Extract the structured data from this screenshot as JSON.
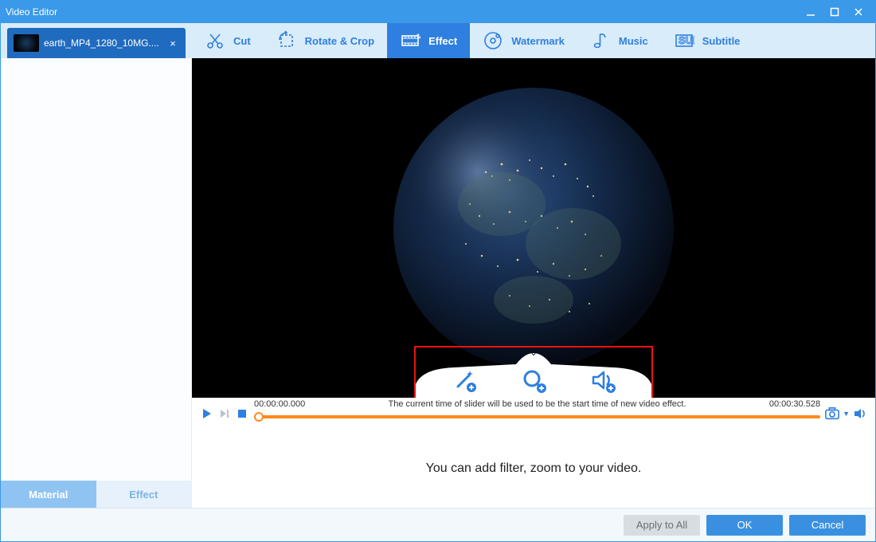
{
  "window": {
    "title": "Video Editor"
  },
  "file_tab": {
    "name": "earth_MP4_1280_10MG...."
  },
  "tabs": {
    "cut": "Cut",
    "rotate": "Rotate & Crop",
    "effect": "Effect",
    "watermark": "Watermark",
    "music": "Music",
    "subtitle": "Subtitle"
  },
  "side_tabs": {
    "material": "Material",
    "effect": "Effect"
  },
  "timeline": {
    "start": "00:00:00.000",
    "end": "00:00:30.528",
    "hint": "The current time of slider will be used to be the start time of new video effect."
  },
  "lower_hint": "You can add filter, zoom to your video.",
  "buttons": {
    "apply_all": "Apply to All",
    "ok": "OK",
    "cancel": "Cancel"
  },
  "effect_tools": {
    "wand": "add-filter",
    "zoom": "add-zoom",
    "volume": "add-volume"
  }
}
